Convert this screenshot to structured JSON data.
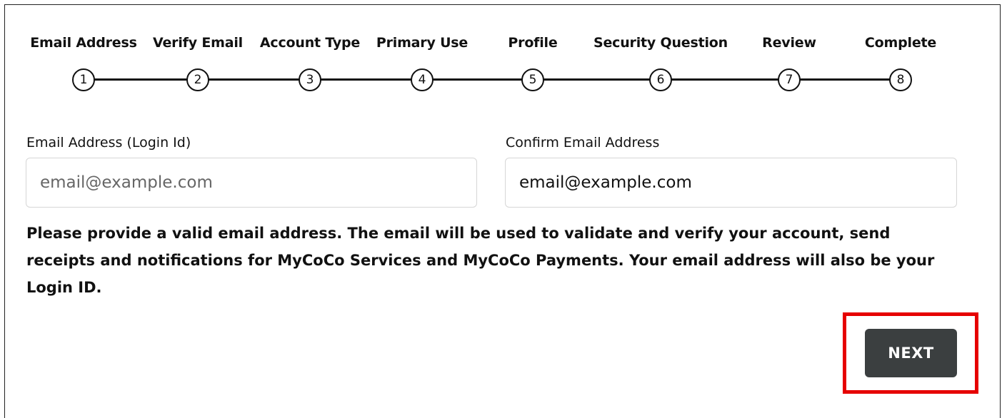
{
  "stepper": {
    "steps": [
      {
        "label": "Email Address",
        "number": "1"
      },
      {
        "label": "Verify Email",
        "number": "2"
      },
      {
        "label": "Account Type",
        "number": "3"
      },
      {
        "label": "Primary Use",
        "number": "4"
      },
      {
        "label": "Profile",
        "number": "5"
      },
      {
        "label": "Security Question",
        "number": "6"
      },
      {
        "label": "Review",
        "number": "7"
      },
      {
        "label": "Complete",
        "number": "8"
      }
    ]
  },
  "form": {
    "email": {
      "label": "Email Address (Login Id)",
      "placeholder": "email@example.com",
      "value": ""
    },
    "confirm_email": {
      "label": "Confirm Email Address",
      "placeholder": "email@example.com",
      "value": "email@example.com"
    },
    "help_text": "Please provide a valid email address. The email will be used to validate and verify your account, send receipts and notifications for MyCoCo Services and MyCoCo Payments. Your email address will also be your Login ID."
  },
  "actions": {
    "next_label": "NEXT"
  },
  "colors": {
    "next_button_bg": "#3b3f40",
    "highlight_border": "#e60000"
  }
}
